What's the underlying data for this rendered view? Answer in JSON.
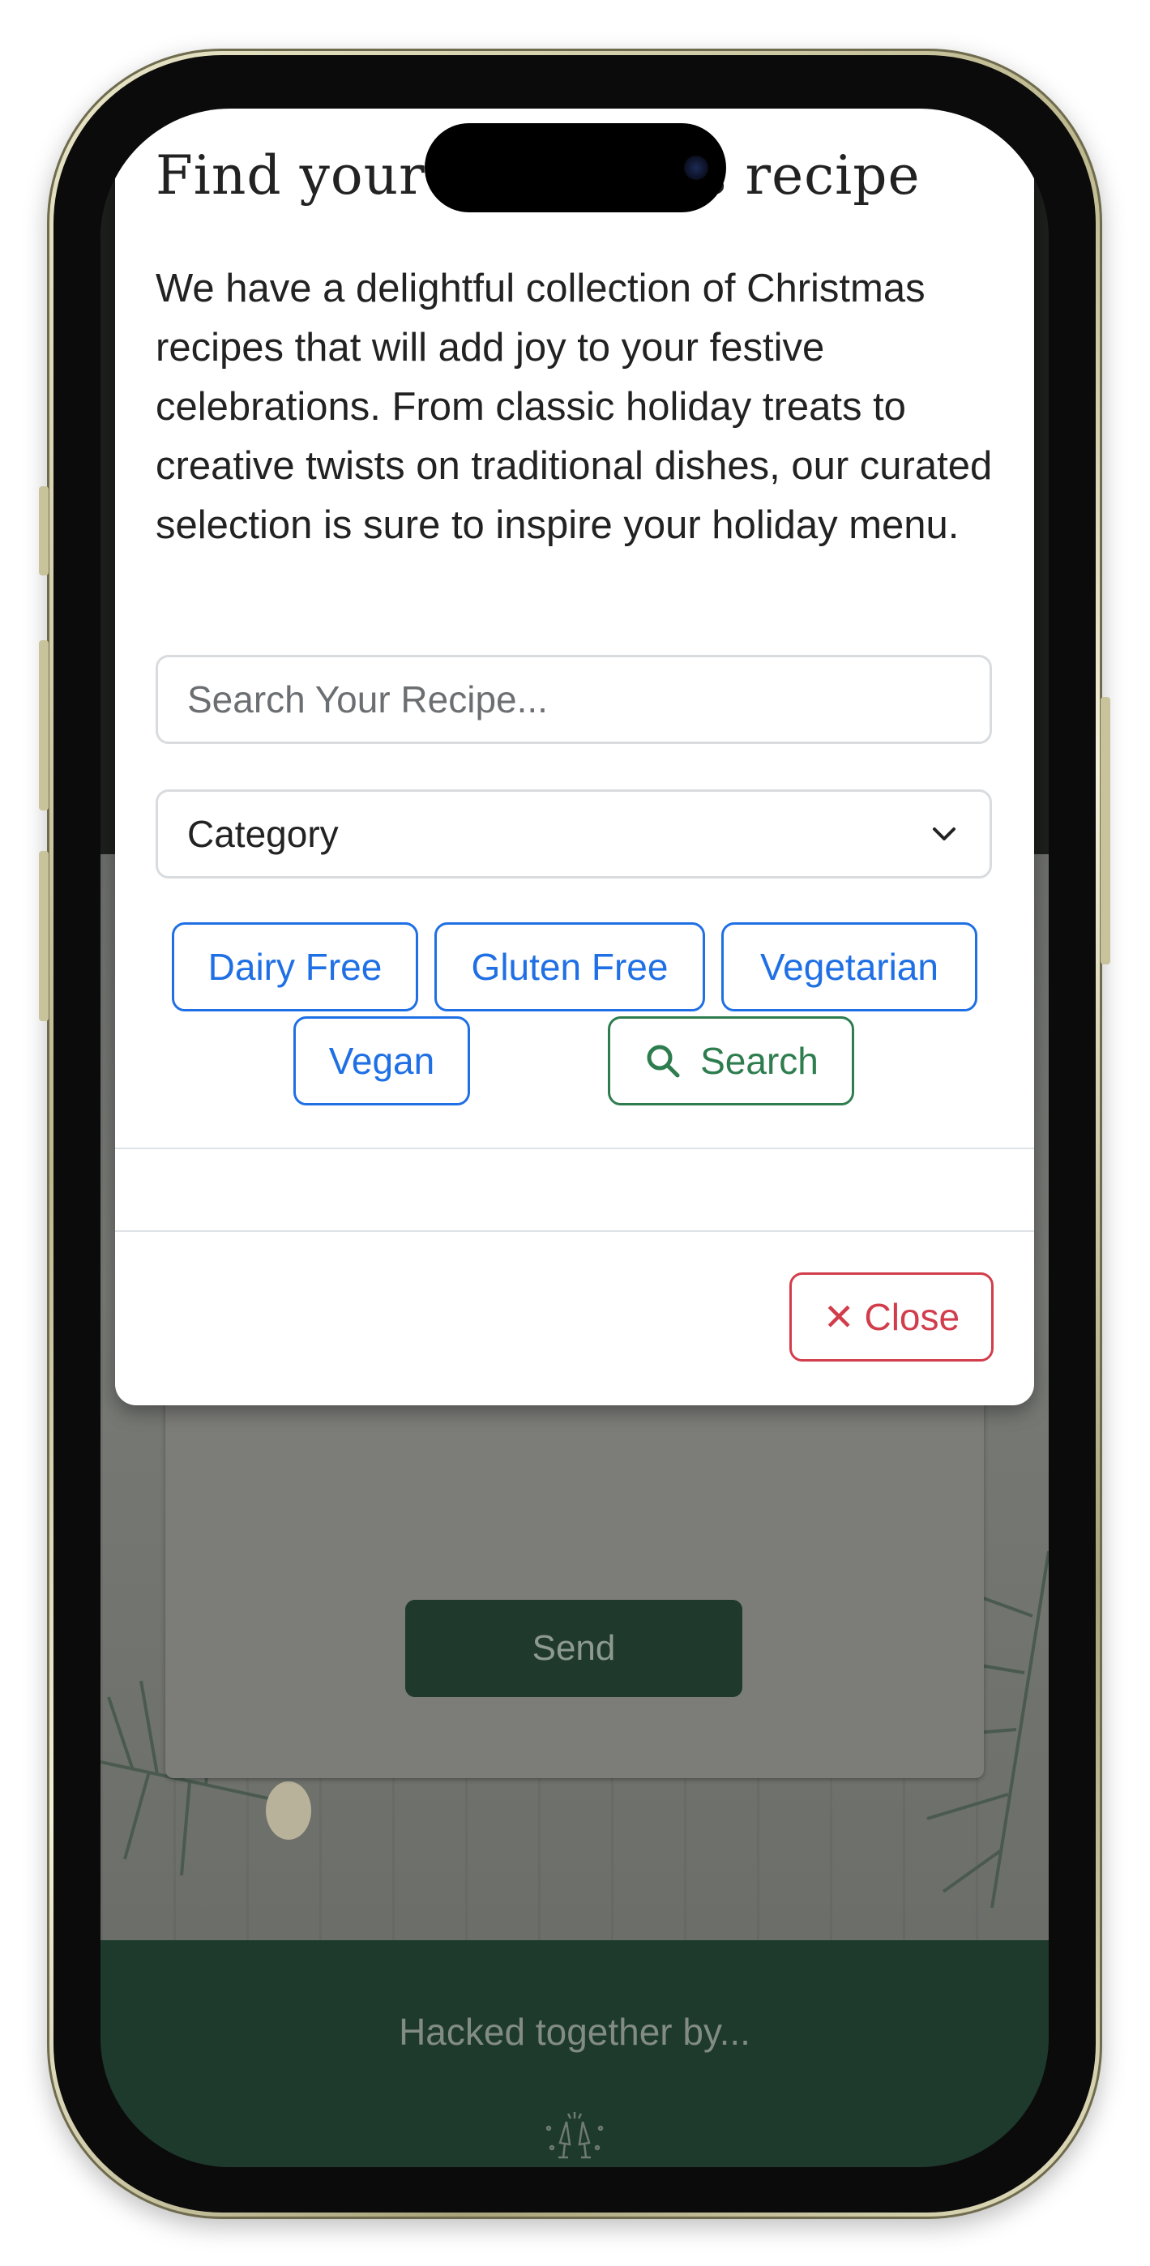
{
  "modal": {
    "title": "Find your Christmas recipe",
    "description": "We have a delightful collection of Christmas recipes that will add joy to your festive celebrations. From classic holiday treats to creative twists on traditional dishes, our curated selection is sure to inspire your holiday menu.",
    "search_placeholder": "Search Your Recipe...",
    "category_label": "Category",
    "filters": [
      "Dairy Free",
      "Gluten Free",
      "Vegetarian",
      "Vegan"
    ],
    "search_label": "Search",
    "close_label": "Close",
    "close_glyph": "✕"
  },
  "background": {
    "send_label": "Send",
    "footer_text": "Hacked together by..."
  },
  "colors": {
    "primary_blue": "#1f6fe5",
    "success_green": "#2e7d4f",
    "danger_red": "#d23d4b",
    "footer_green": "#1d3a2c"
  }
}
